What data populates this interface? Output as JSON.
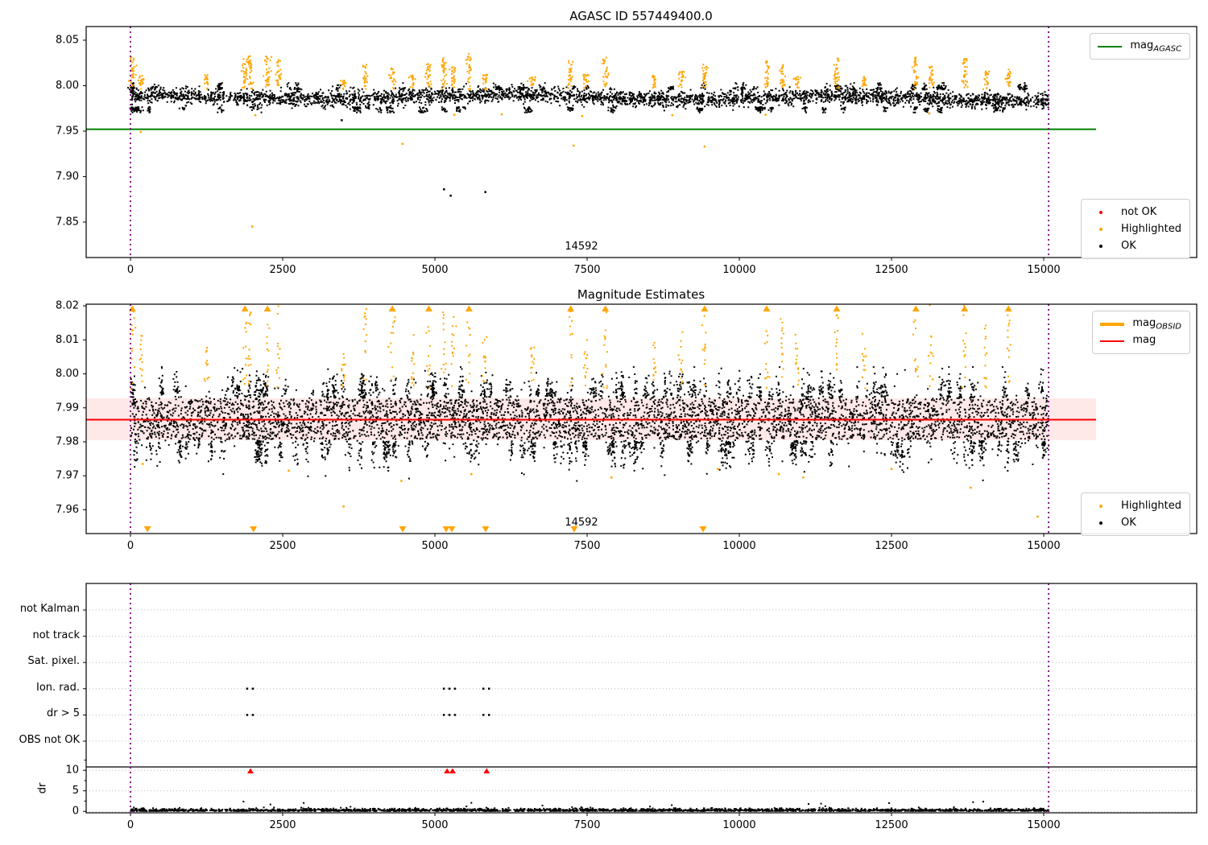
{
  "colors": {
    "ok": "#000000",
    "highlighted": "#ffa500",
    "not_ok": "#ff0000",
    "agasc_line": "#008000",
    "mag_line": "#ff0000",
    "obsid_boundary": "#800080",
    "grid": "#bcbcbc",
    "err_band_fill": "rgba(255,0,0,0.09)"
  },
  "chart_data": [
    {
      "type": "scatter",
      "title": "AGASC ID 557449400.0",
      "xlim": [
        -728,
        17513
      ],
      "ylim": [
        7.811,
        8.065
      ],
      "xticks": [
        {
          "v": 0,
          "label": "0"
        },
        {
          "v": 2500,
          "label": "2500"
        },
        {
          "v": 5000,
          "label": "5000"
        },
        {
          "v": 7500,
          "label": "7500"
        },
        {
          "v": 10000,
          "label": "10000"
        },
        {
          "v": 12500,
          "label": "12500"
        },
        {
          "v": 15000,
          "label": "15000"
        }
      ],
      "yticks": [
        {
          "v": 8.05,
          "label": "8.05"
        },
        {
          "v": 8.0,
          "label": "8.00"
        },
        {
          "v": 7.95,
          "label": "7.95"
        },
        {
          "v": 7.9,
          "label": "7.90"
        },
        {
          "v": 7.85,
          "label": "7.85"
        }
      ],
      "agasc_line": {
        "y": 7.952,
        "x_start": -728,
        "x_end": 15860
      },
      "obsid_boundaries": [
        0,
        15080
      ],
      "ok_band": {
        "x_min": 0,
        "x_max": 15080,
        "mean": 7.9868,
        "sigma": 0.0042,
        "n": 3600
      },
      "highlight_clusters": [
        [
          30,
          8.033
        ],
        [
          170,
          8.012
        ],
        [
          1250,
          8.012
        ],
        [
          1880,
          8.03
        ],
        [
          1960,
          8.033
        ],
        [
          2250,
          8.035
        ],
        [
          2430,
          8.029
        ],
        [
          3500,
          8.006
        ],
        [
          3850,
          8.023
        ],
        [
          4300,
          8.02
        ],
        [
          4640,
          8.012
        ],
        [
          4900,
          8.025
        ],
        [
          5150,
          8.031
        ],
        [
          5300,
          8.022
        ],
        [
          5560,
          8.035
        ],
        [
          5820,
          8.012
        ],
        [
          6600,
          8.01
        ],
        [
          7230,
          8.028
        ],
        [
          7480,
          8.013
        ],
        [
          7800,
          8.031
        ],
        [
          8600,
          8.011
        ],
        [
          9050,
          8.016
        ],
        [
          9430,
          8.026
        ],
        [
          10450,
          8.029
        ],
        [
          10700,
          8.024
        ],
        [
          10950,
          8.012
        ],
        [
          11600,
          8.031
        ],
        [
          12050,
          8.013
        ],
        [
          12900,
          8.031
        ],
        [
          13150,
          8.021
        ],
        [
          13700,
          8.031
        ],
        [
          14050,
          8.016
        ],
        [
          14420,
          8.021
        ]
      ],
      "ok_outliers": [
        [
          3470,
          7.962
        ],
        [
          5150,
          7.886
        ],
        [
          5260,
          7.879
        ],
        [
          5830,
          7.883
        ]
      ],
      "highlight_outliers": [
        [
          170,
          7.949
        ],
        [
          2000,
          7.845
        ],
        [
          4470,
          7.936
        ],
        [
          7280,
          7.934
        ],
        [
          9430,
          7.933
        ],
        [
          2050,
          7.9675
        ],
        [
          5320,
          7.968
        ],
        [
          7420,
          7.9665
        ],
        [
          10430,
          7.968
        ],
        [
          13120,
          7.9695
        ],
        [
          6100,
          7.9685
        ],
        [
          8900,
          7.9675
        ]
      ],
      "annotation": {
        "text": "14592",
        "x": 7400
      },
      "legend_line": [
        {
          "label": "mag",
          "sub": "AGASC"
        }
      ],
      "legend_points": [
        {
          "label": "not OK"
        },
        {
          "label": "Highlighted"
        },
        {
          "label": "OK"
        }
      ]
    },
    {
      "type": "scatter",
      "title": "Magnitude Estimates",
      "xlim": [
        -728,
        17513
      ],
      "ylim": [
        7.953,
        8.0205
      ],
      "xticks": [
        {
          "v": 0,
          "label": "0"
        },
        {
          "v": 2500,
          "label": "2500"
        },
        {
          "v": 5000,
          "label": "5000"
        },
        {
          "v": 7500,
          "label": "7500"
        },
        {
          "v": 10000,
          "label": "10000"
        },
        {
          "v": 12500,
          "label": "12500"
        },
        {
          "v": 15000,
          "label": "15000"
        }
      ],
      "yticks": [
        {
          "v": 8.02,
          "label": "8.02"
        },
        {
          "v": 8.01,
          "label": "8.01"
        },
        {
          "v": 8.0,
          "label": "8.00"
        },
        {
          "v": 7.99,
          "label": "7.99"
        },
        {
          "v": 7.98,
          "label": "7.98"
        },
        {
          "v": 7.97,
          "label": "7.97"
        },
        {
          "v": 7.96,
          "label": "7.96"
        }
      ],
      "mag_line": {
        "y": 7.9865,
        "x_start": -728,
        "x_end": 15860
      },
      "err_band": {
        "y0": 7.9805,
        "y1": 7.9928,
        "x_start": -728,
        "x_end": 15860
      },
      "obsid_boundaries": [
        0,
        15080
      ],
      "ok_band": {
        "x_min": 0,
        "x_max": 15080,
        "y0": 7.9807,
        "y1": 7.9926,
        "n": 3400,
        "spill_mean": 7.9868,
        "spill_sigma": 0.005,
        "spill_n": 1200
      },
      "highlight_clusters": [
        [
          30,
          8.033
        ],
        [
          170,
          8.012
        ],
        [
          1250,
          8.012
        ],
        [
          1880,
          8.03
        ],
        [
          1960,
          8.033
        ],
        [
          2250,
          8.035
        ],
        [
          2430,
          8.029
        ],
        [
          3500,
          8.006
        ],
        [
          3850,
          8.023
        ],
        [
          4300,
          8.02
        ],
        [
          4640,
          8.012
        ],
        [
          4900,
          8.025
        ],
        [
          5150,
          8.031
        ],
        [
          5300,
          8.022
        ],
        [
          5560,
          8.035
        ],
        [
          5820,
          8.012
        ],
        [
          6600,
          8.01
        ],
        [
          7230,
          8.028
        ],
        [
          7480,
          8.013
        ],
        [
          7800,
          8.031
        ],
        [
          8600,
          8.011
        ],
        [
          9050,
          8.016
        ],
        [
          9430,
          8.026
        ],
        [
          10450,
          8.029
        ],
        [
          10700,
          8.024
        ],
        [
          10950,
          8.012
        ],
        [
          11600,
          8.031
        ],
        [
          12050,
          8.013
        ],
        [
          12900,
          8.031
        ],
        [
          13150,
          8.021
        ],
        [
          13700,
          8.031
        ],
        [
          14050,
          8.016
        ],
        [
          14420,
          8.021
        ]
      ],
      "clip_top_x": [
        30,
        1880,
        2250,
        4300,
        4900,
        5560,
        7230,
        7800,
        9430,
        10450,
        11600,
        12900,
        13700,
        14420
      ],
      "clip_bottom_x": [
        280,
        2020,
        4470,
        5185,
        5278,
        5833,
        7288,
        9404
      ],
      "highlight_outliers": [
        [
          3500,
          7.961
        ],
        [
          4450,
          7.9685
        ],
        [
          5600,
          7.9705
        ],
        [
          7900,
          7.9695
        ],
        [
          9650,
          7.972
        ],
        [
          10650,
          7.9705
        ],
        [
          11050,
          7.9695
        ],
        [
          12500,
          7.972
        ],
        [
          13800,
          7.9665
        ],
        [
          14900,
          7.958
        ],
        [
          200,
          7.9735
        ],
        [
          2600,
          7.9715
        ]
      ],
      "annotation": {
        "text": "14592",
        "x": 7400
      },
      "legend_lines": [
        {
          "label": "mag",
          "sub": "OBSID"
        },
        {
          "label": "mag",
          "sub": ""
        }
      ],
      "legend_points": [
        {
          "label": "Highlighted"
        },
        {
          "label": "OK"
        }
      ]
    },
    {
      "type": "scatter",
      "title": "",
      "xlim": [
        -728,
        17513
      ],
      "xticks": [
        {
          "v": 0,
          "label": "0"
        },
        {
          "v": 2500,
          "label": "2500"
        },
        {
          "v": 5000,
          "label": "5000"
        },
        {
          "v": 7500,
          "label": "7500"
        },
        {
          "v": 10000,
          "label": "10000"
        },
        {
          "v": 12500,
          "label": "12500"
        },
        {
          "v": 15000,
          "label": "15000"
        }
      ],
      "categories": [
        "not Kalman",
        "not track",
        "Sat. pixel.",
        "Ion. rad.",
        "dr > 5",
        "OBS not OK"
      ],
      "dr_axis": {
        "label": "dr",
        "ticks": [
          {
            "v": 10,
            "label": "10"
          },
          {
            "v": 5,
            "label": "5"
          },
          {
            "v": 0,
            "label": "0"
          }
        ]
      },
      "flag_hits": [
        {
          "category": "Ion. rad.",
          "x": [
            1970,
            5200,
            5290,
            5850
          ]
        },
        {
          "category": "dr > 5",
          "x": [
            1970,
            5200,
            5290,
            5850
          ]
        }
      ],
      "dr_clipped_x": [
        1970,
        5200,
        5290,
        5850
      ],
      "dr_strip": {
        "x_min": 0,
        "x_max": 15080,
        "n": 2400
      },
      "obsid_boundaries": [
        0,
        15080
      ]
    }
  ]
}
